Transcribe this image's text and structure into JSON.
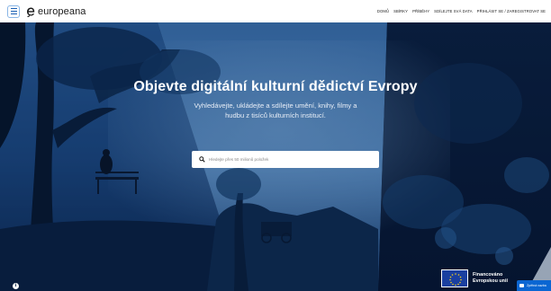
{
  "header": {
    "logo_text": "europeana",
    "nav": [
      {
        "label": "DOMŮ"
      },
      {
        "label": "SBÍRKY"
      },
      {
        "label": "PŘÍBĚHY"
      },
      {
        "label": "SDÍLEJTE SVÁ DATA"
      },
      {
        "label": "PŘIHLÁSIT SE / ZAREGISTROVAT SE"
      }
    ]
  },
  "hero": {
    "title": "Objevte digitální kulturní dědictví Evropy",
    "subtitle": "Vyhledávejte, ukládejte a sdílejte umění, knihy, filmy a hudbu z tisíců kulturních institucí.",
    "search_placeholder": "Hledejte přes 50 milionů položek"
  },
  "eu_banner": {
    "line1": "Financováno",
    "line2": "Evropskou unií"
  },
  "feedback": {
    "label": "Zpětná vazba"
  },
  "colors": {
    "accent": "#0b66d2",
    "hero_overlay": "#0a1e3f"
  }
}
